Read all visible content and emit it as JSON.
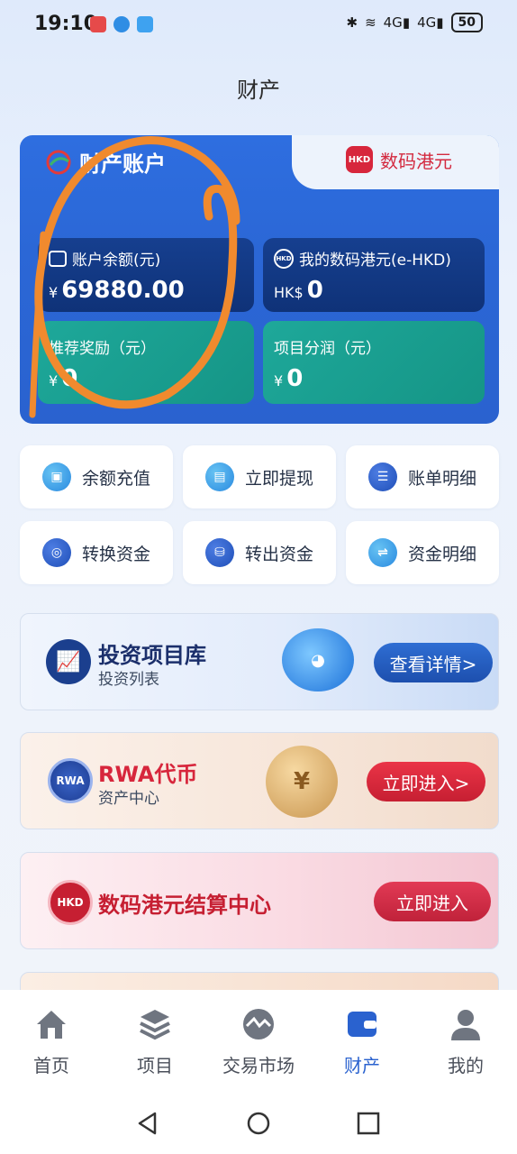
{
  "status_bar": {
    "time": "19:10",
    "battery": "50",
    "signal1": "4G",
    "signal2": "4G"
  },
  "page_title": "财产",
  "account_card": {
    "tab_left": "财产账户",
    "tab_right": "数码港元",
    "tab_right_badge": "HKD",
    "balance": {
      "label": "账户余额(元)",
      "currency": "¥",
      "value": "69880.00"
    },
    "ehkd": {
      "label": "我的数码港元(e-HKD)",
      "currency": "HK$",
      "value": "0",
      "badge": "HKD"
    },
    "reward": {
      "label": "推荐奖励（元）",
      "currency": "¥",
      "value": "0"
    },
    "profit": {
      "label": "项目分润（元）",
      "currency": "¥",
      "value": "0"
    }
  },
  "actions": [
    {
      "label": "余额充值",
      "icon": "wallet-recharge-icon"
    },
    {
      "label": "立即提现",
      "icon": "withdraw-icon"
    },
    {
      "label": "账单明细",
      "icon": "bill-detail-icon"
    },
    {
      "label": "转换资金",
      "icon": "convert-funds-icon"
    },
    {
      "label": "转出资金",
      "icon": "transfer-out-icon"
    },
    {
      "label": "资金明细",
      "icon": "funds-detail-icon"
    }
  ],
  "banners": {
    "invest": {
      "title": "投资项目库",
      "subtitle": "投资列表",
      "button": "查看详情>"
    },
    "rwa": {
      "title": "RWA代币",
      "subtitle": "资产中心",
      "button": "立即进入>",
      "badge": "RWA"
    },
    "ehkd": {
      "title": "数码港元结算中心",
      "button": "立即进入",
      "badge": "HKD"
    }
  },
  "tab_bar": [
    {
      "label": "首页",
      "icon": "home-icon"
    },
    {
      "label": "项目",
      "icon": "layers-icon"
    },
    {
      "label": "交易市场",
      "icon": "market-icon"
    },
    {
      "label": "财产",
      "icon": "wallet-icon",
      "active": true
    },
    {
      "label": "我的",
      "icon": "user-icon"
    }
  ],
  "colors": {
    "primary": "#2a62cf",
    "teal": "#1ea89a",
    "red": "#d7263c",
    "scribble": "#f08a2e"
  }
}
